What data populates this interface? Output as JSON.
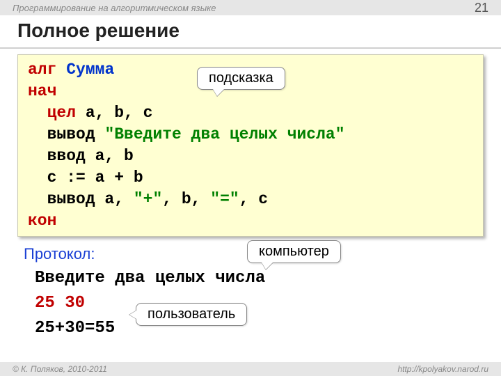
{
  "header": {
    "subject": "Программирование на алгоритмическом языке",
    "page": "21"
  },
  "title": "Полное решение",
  "code": {
    "l1_kw": "алг",
    "l1_name": "Сумма",
    "l2_kw": "нач",
    "l3_type": "цел",
    "l3_vars": " a, b, c",
    "l4a": "вывод ",
    "l4b": "\"Введите два целых числа\"",
    "l5": "ввод a, b",
    "l6": "c := a + b",
    "l7a": "вывод a, ",
    "l7b": "\"+\"",
    "l7c": ", b, ",
    "l7d": "\"=\"",
    "l7e": ", c",
    "l8_kw": "кон"
  },
  "protocol": {
    "label": "Протокол:",
    "line1": "Введите два целых числа",
    "line2": "25 30",
    "line3": "25+30=55"
  },
  "callouts": {
    "hint": "подсказка",
    "computer": "компьютер",
    "user": "пользователь"
  },
  "footer": {
    "copyright": "© К. Поляков, 2010-2011",
    "url": "http://kpolyakov.narod.ru"
  }
}
